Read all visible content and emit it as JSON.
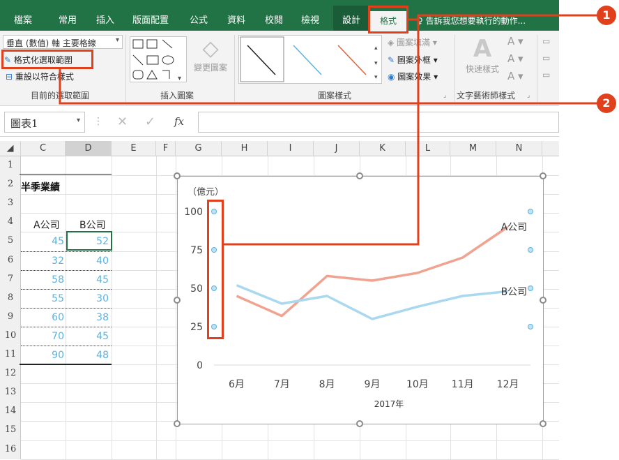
{
  "tabs": [
    "檔案",
    "常用",
    "插入",
    "版面配置",
    "公式",
    "資料",
    "校閱",
    "檢視",
    "設計",
    "格式"
  ],
  "tell_me": "告訴我您想要執行的動作...",
  "ribbon": {
    "selection_dropdown": "垂直 (數值) 軸 主要格線",
    "format_selection": "格式化選取範圍",
    "reset_style": "重設以符合樣式",
    "group_current_selection": "目前的選取範圍",
    "group_insert_shapes": "插入圖案",
    "change_shape": "變更圖案",
    "group_shape_styles": "圖案樣式",
    "shape_fill": "圖案填滿",
    "shape_outline": "圖案外框",
    "shape_effects": "圖案效果",
    "quick_styles": "快速樣式",
    "group_wordart": "文字藝術師樣式"
  },
  "formula_bar": {
    "name_box": "圖表1",
    "fx": "fx"
  },
  "columns": [
    "C",
    "D",
    "E",
    "F",
    "G",
    "H",
    "I",
    "J",
    "K",
    "L",
    "M",
    "N"
  ],
  "rows": [
    "1",
    "2",
    "3",
    "4",
    "5",
    "6",
    "7",
    "8",
    "9",
    "10",
    "11",
    "12",
    "13",
    "14",
    "15",
    "16"
  ],
  "sheet": {
    "title": "半季業績",
    "header_a": "A公司",
    "header_b": "B公司",
    "values_a": [
      "45",
      "32",
      "58",
      "55",
      "60",
      "70",
      "90"
    ],
    "values_b": [
      "52",
      "40",
      "45",
      "30",
      "38",
      "45",
      "48"
    ]
  },
  "chart_data": {
    "type": "line",
    "title": "",
    "ylabel": "（億元）",
    "xlabel": "2017年",
    "categories": [
      "6月",
      "7月",
      "8月",
      "9月",
      "10月",
      "11月",
      "12月"
    ],
    "y_ticks": [
      "100",
      "75",
      "50",
      "25",
      "0"
    ],
    "ylim": [
      0,
      100
    ],
    "series": [
      {
        "name": "A公司",
        "values": [
          45,
          32,
          58,
          55,
          60,
          70,
          90
        ],
        "color": "#f0a391"
      },
      {
        "name": "B公司",
        "values": [
          52,
          40,
          45,
          30,
          38,
          45,
          48
        ],
        "color": "#a9d8ef"
      }
    ]
  },
  "callouts": [
    "1",
    "2"
  ],
  "colors": {
    "excel_green": "#217346",
    "callout_red": "#e0401b"
  }
}
